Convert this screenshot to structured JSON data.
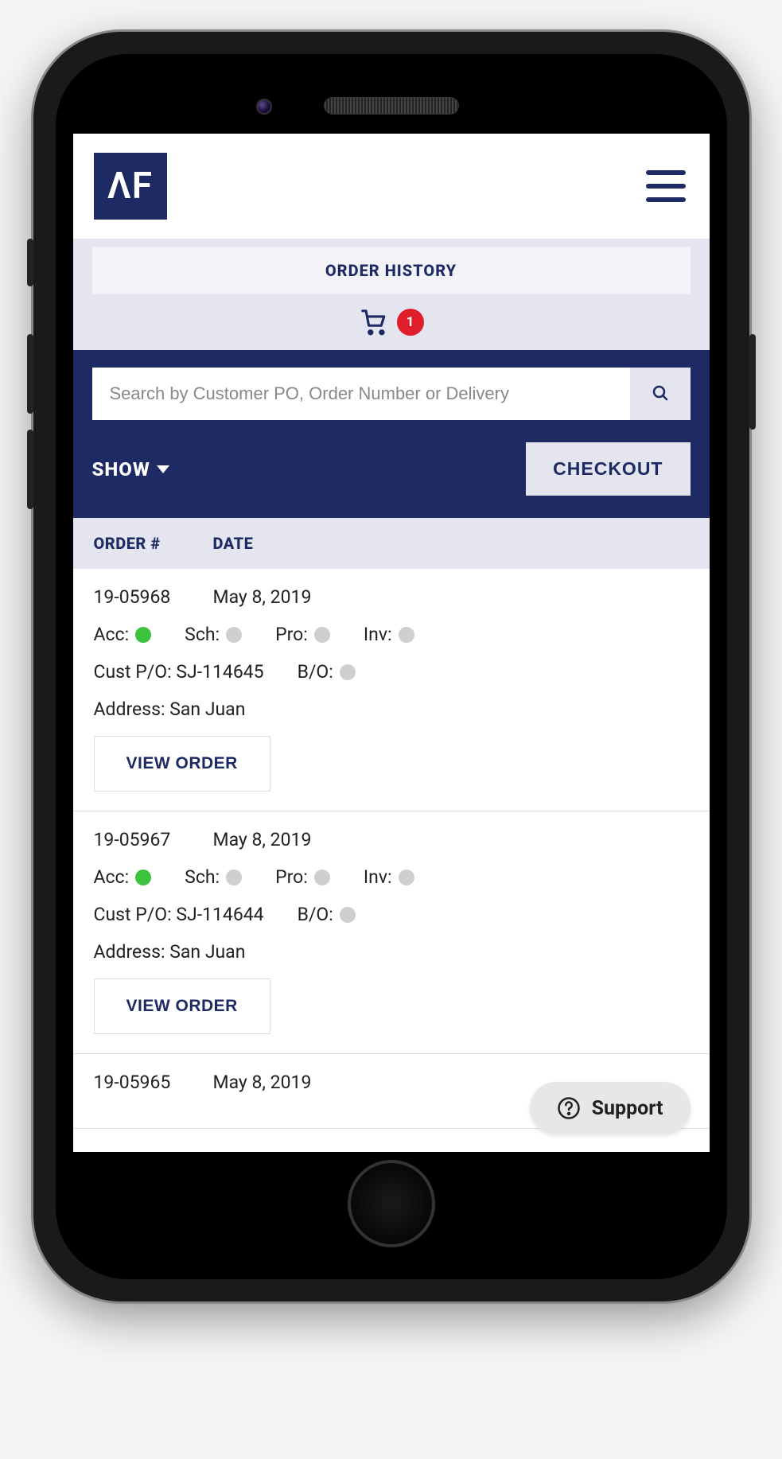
{
  "header": {
    "logo_text": "ΛF"
  },
  "page": {
    "title": "ORDER HISTORY",
    "cart_count": "1"
  },
  "search": {
    "placeholder": "Search by Customer PO, Order Number or Delivery"
  },
  "actions": {
    "show_label": "SHOW",
    "checkout_label": "CHECKOUT"
  },
  "table": {
    "col_order": "ORDER #",
    "col_date": "DATE"
  },
  "labels": {
    "acc": "Acc:",
    "sch": "Sch:",
    "pro": "Pro:",
    "inv": "Inv:",
    "cust_po": "Cust P/O:",
    "bo": "B/O:",
    "address": "Address:",
    "view_order": "VIEW ORDER"
  },
  "orders": [
    {
      "number": "19-05968",
      "date": "May 8, 2019",
      "acc": "green",
      "sch": "grey",
      "pro": "grey",
      "inv": "grey",
      "cust_po": "SJ-114645",
      "bo": "grey",
      "address": "San Juan"
    },
    {
      "number": "19-05967",
      "date": "May 8, 2019",
      "acc": "green",
      "sch": "grey",
      "pro": "grey",
      "inv": "grey",
      "cust_po": "SJ-114644",
      "bo": "grey",
      "address": "San Juan"
    },
    {
      "number": "19-05965",
      "date": "May 8, 2019"
    }
  ],
  "support": {
    "label": "Support"
  }
}
